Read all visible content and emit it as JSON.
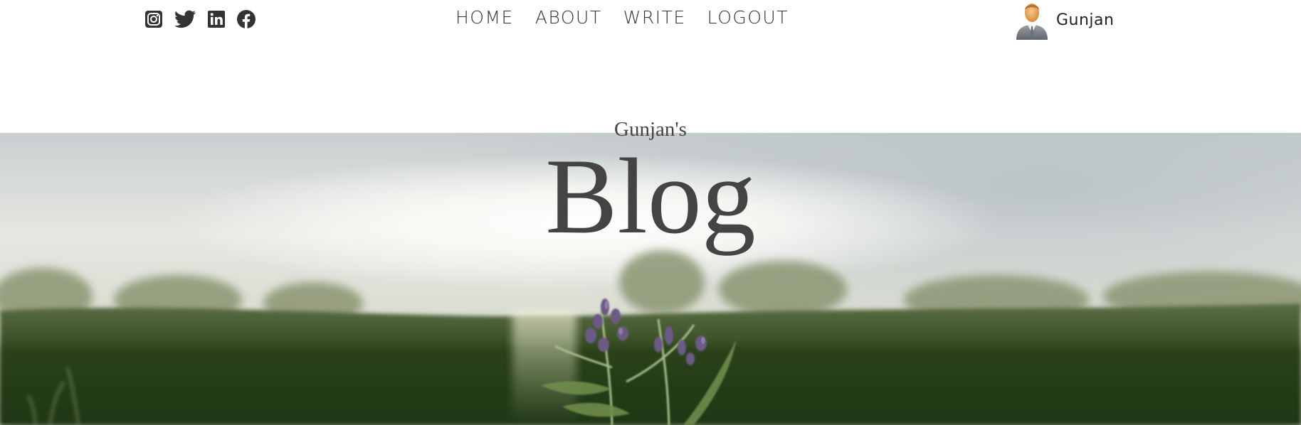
{
  "social": {
    "items": [
      {
        "name": "instagram-icon"
      },
      {
        "name": "twitter-icon"
      },
      {
        "name": "linkedin-icon"
      },
      {
        "name": "facebook-icon"
      }
    ]
  },
  "nav": {
    "items": [
      {
        "label": "HOME"
      },
      {
        "label": "ABOUT"
      },
      {
        "label": "WRITE"
      },
      {
        "label": "LOGOUT"
      }
    ]
  },
  "user": {
    "name": "Gunjan",
    "avatar_icon": "user-avatar-icon"
  },
  "header": {
    "subtitle": "Gunjan's",
    "title": "Blog",
    "background_image": "blurred meadow with purple wildflowers at sunset"
  },
  "colors": {
    "text": "#444444",
    "icon": "#333333",
    "background": "#ffffff"
  }
}
